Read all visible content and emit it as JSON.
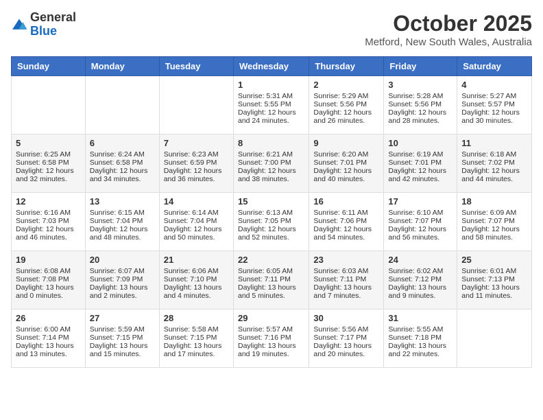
{
  "logo": {
    "general": "General",
    "blue": "Blue"
  },
  "header": {
    "month": "October 2025",
    "location": "Metford, New South Wales, Australia"
  },
  "weekdays": [
    "Sunday",
    "Monday",
    "Tuesday",
    "Wednesday",
    "Thursday",
    "Friday",
    "Saturday"
  ],
  "weeks": [
    [
      {
        "day": "",
        "sunrise": "",
        "sunset": "",
        "daylight": ""
      },
      {
        "day": "",
        "sunrise": "",
        "sunset": "",
        "daylight": ""
      },
      {
        "day": "",
        "sunrise": "",
        "sunset": "",
        "daylight": ""
      },
      {
        "day": "1",
        "sunrise": "Sunrise: 5:31 AM",
        "sunset": "Sunset: 5:55 PM",
        "daylight": "Daylight: 12 hours and 24 minutes."
      },
      {
        "day": "2",
        "sunrise": "Sunrise: 5:29 AM",
        "sunset": "Sunset: 5:56 PM",
        "daylight": "Daylight: 12 hours and 26 minutes."
      },
      {
        "day": "3",
        "sunrise": "Sunrise: 5:28 AM",
        "sunset": "Sunset: 5:56 PM",
        "daylight": "Daylight: 12 hours and 28 minutes."
      },
      {
        "day": "4",
        "sunrise": "Sunrise: 5:27 AM",
        "sunset": "Sunset: 5:57 PM",
        "daylight": "Daylight: 12 hours and 30 minutes."
      }
    ],
    [
      {
        "day": "5",
        "sunrise": "Sunrise: 6:25 AM",
        "sunset": "Sunset: 6:58 PM",
        "daylight": "Daylight: 12 hours and 32 minutes."
      },
      {
        "day": "6",
        "sunrise": "Sunrise: 6:24 AM",
        "sunset": "Sunset: 6:58 PM",
        "daylight": "Daylight: 12 hours and 34 minutes."
      },
      {
        "day": "7",
        "sunrise": "Sunrise: 6:23 AM",
        "sunset": "Sunset: 6:59 PM",
        "daylight": "Daylight: 12 hours and 36 minutes."
      },
      {
        "day": "8",
        "sunrise": "Sunrise: 6:21 AM",
        "sunset": "Sunset: 7:00 PM",
        "daylight": "Daylight: 12 hours and 38 minutes."
      },
      {
        "day": "9",
        "sunrise": "Sunrise: 6:20 AM",
        "sunset": "Sunset: 7:01 PM",
        "daylight": "Daylight: 12 hours and 40 minutes."
      },
      {
        "day": "10",
        "sunrise": "Sunrise: 6:19 AM",
        "sunset": "Sunset: 7:01 PM",
        "daylight": "Daylight: 12 hours and 42 minutes."
      },
      {
        "day": "11",
        "sunrise": "Sunrise: 6:18 AM",
        "sunset": "Sunset: 7:02 PM",
        "daylight": "Daylight: 12 hours and 44 minutes."
      }
    ],
    [
      {
        "day": "12",
        "sunrise": "Sunrise: 6:16 AM",
        "sunset": "Sunset: 7:03 PM",
        "daylight": "Daylight: 12 hours and 46 minutes."
      },
      {
        "day": "13",
        "sunrise": "Sunrise: 6:15 AM",
        "sunset": "Sunset: 7:04 PM",
        "daylight": "Daylight: 12 hours and 48 minutes."
      },
      {
        "day": "14",
        "sunrise": "Sunrise: 6:14 AM",
        "sunset": "Sunset: 7:04 PM",
        "daylight": "Daylight: 12 hours and 50 minutes."
      },
      {
        "day": "15",
        "sunrise": "Sunrise: 6:13 AM",
        "sunset": "Sunset: 7:05 PM",
        "daylight": "Daylight: 12 hours and 52 minutes."
      },
      {
        "day": "16",
        "sunrise": "Sunrise: 6:11 AM",
        "sunset": "Sunset: 7:06 PM",
        "daylight": "Daylight: 12 hours and 54 minutes."
      },
      {
        "day": "17",
        "sunrise": "Sunrise: 6:10 AM",
        "sunset": "Sunset: 7:07 PM",
        "daylight": "Daylight: 12 hours and 56 minutes."
      },
      {
        "day": "18",
        "sunrise": "Sunrise: 6:09 AM",
        "sunset": "Sunset: 7:07 PM",
        "daylight": "Daylight: 12 hours and 58 minutes."
      }
    ],
    [
      {
        "day": "19",
        "sunrise": "Sunrise: 6:08 AM",
        "sunset": "Sunset: 7:08 PM",
        "daylight": "Daylight: 13 hours and 0 minutes."
      },
      {
        "day": "20",
        "sunrise": "Sunrise: 6:07 AM",
        "sunset": "Sunset: 7:09 PM",
        "daylight": "Daylight: 13 hours and 2 minutes."
      },
      {
        "day": "21",
        "sunrise": "Sunrise: 6:06 AM",
        "sunset": "Sunset: 7:10 PM",
        "daylight": "Daylight: 13 hours and 4 minutes."
      },
      {
        "day": "22",
        "sunrise": "Sunrise: 6:05 AM",
        "sunset": "Sunset: 7:11 PM",
        "daylight": "Daylight: 13 hours and 5 minutes."
      },
      {
        "day": "23",
        "sunrise": "Sunrise: 6:03 AM",
        "sunset": "Sunset: 7:11 PM",
        "daylight": "Daylight: 13 hours and 7 minutes."
      },
      {
        "day": "24",
        "sunrise": "Sunrise: 6:02 AM",
        "sunset": "Sunset: 7:12 PM",
        "daylight": "Daylight: 13 hours and 9 minutes."
      },
      {
        "day": "25",
        "sunrise": "Sunrise: 6:01 AM",
        "sunset": "Sunset: 7:13 PM",
        "daylight": "Daylight: 13 hours and 11 minutes."
      }
    ],
    [
      {
        "day": "26",
        "sunrise": "Sunrise: 6:00 AM",
        "sunset": "Sunset: 7:14 PM",
        "daylight": "Daylight: 13 hours and 13 minutes."
      },
      {
        "day": "27",
        "sunrise": "Sunrise: 5:59 AM",
        "sunset": "Sunset: 7:15 PM",
        "daylight": "Daylight: 13 hours and 15 minutes."
      },
      {
        "day": "28",
        "sunrise": "Sunrise: 5:58 AM",
        "sunset": "Sunset: 7:15 PM",
        "daylight": "Daylight: 13 hours and 17 minutes."
      },
      {
        "day": "29",
        "sunrise": "Sunrise: 5:57 AM",
        "sunset": "Sunset: 7:16 PM",
        "daylight": "Daylight: 13 hours and 19 minutes."
      },
      {
        "day": "30",
        "sunrise": "Sunrise: 5:56 AM",
        "sunset": "Sunset: 7:17 PM",
        "daylight": "Daylight: 13 hours and 20 minutes."
      },
      {
        "day": "31",
        "sunrise": "Sunrise: 5:55 AM",
        "sunset": "Sunset: 7:18 PM",
        "daylight": "Daylight: 13 hours and 22 minutes."
      },
      {
        "day": "",
        "sunrise": "",
        "sunset": "",
        "daylight": ""
      }
    ]
  ]
}
